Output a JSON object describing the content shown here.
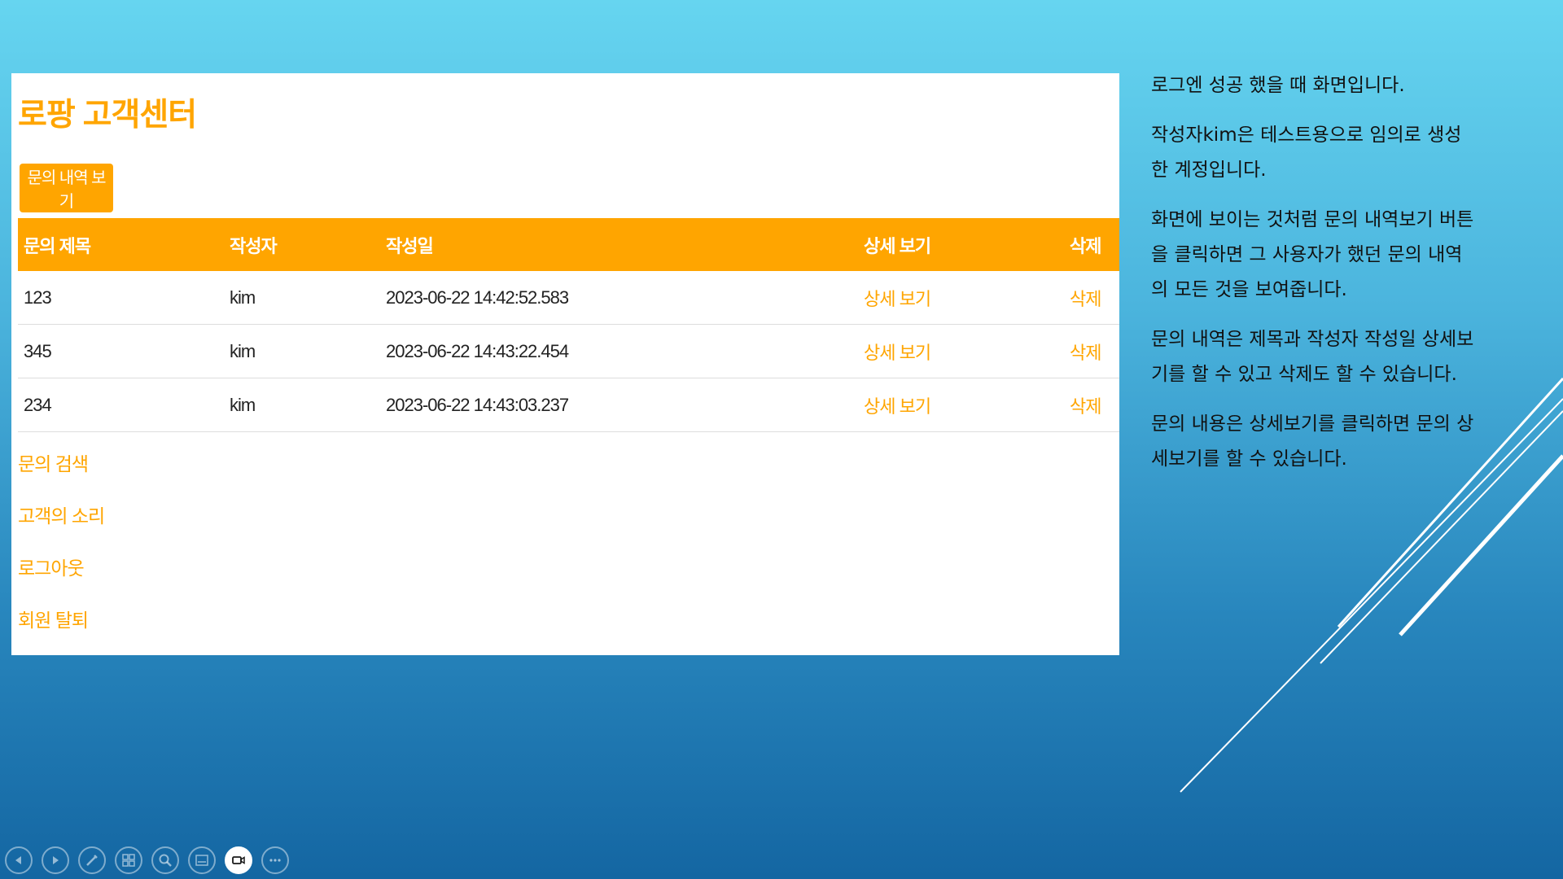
{
  "site": {
    "title": "로팡 고객센터",
    "inquiry_button": "문의 내역 보기"
  },
  "table": {
    "headers": [
      "문의 제목",
      "작성자",
      "작성일",
      "상세 보기",
      "삭제"
    ],
    "rows": [
      {
        "title": "123",
        "author": "kim",
        "date": "2023-06-22 14:42:52.583",
        "detail": "상세 보기",
        "delete": "삭제"
      },
      {
        "title": "345",
        "author": "kim",
        "date": "2023-06-22 14:43:22.454",
        "detail": "상세 보기",
        "delete": "삭제"
      },
      {
        "title": "234",
        "author": "kim",
        "date": "2023-06-22 14:43:03.237",
        "detail": "상세 보기",
        "delete": "삭제"
      }
    ]
  },
  "links": [
    "문의 검색",
    "고객의 소리",
    "로그아웃",
    "회원 탈퇴"
  ],
  "notes": [
    "로그엔 성공 했을 때 화면입니다.",
    "작성자kim은 테스트용으로 임의로 생성한 계정입니다.",
    "화면에 보이는 것처럼 문의 내역보기 버튼을 클릭하면 그 사용자가 했던 문의 내역의 모든 것을 보여줍니다.",
    "문의 내역은 제목과 작성자 작성일 상세보기를 할 수 있고 삭제도 할 수 있습니다.",
    "문의 내용은 상세보기를 클릭하면 문의 상세보기를 할 수 있습니다."
  ],
  "colors": {
    "accent": "#ffa500",
    "background_top": "#66d5f0",
    "background_bottom": "#1466a2"
  },
  "toolbar": {
    "icons": [
      "previous-slide-icon",
      "next-slide-icon",
      "pen-icon",
      "slides-grid-icon",
      "zoom-icon",
      "subtitles-icon",
      "camera-icon",
      "more-options-icon"
    ]
  }
}
